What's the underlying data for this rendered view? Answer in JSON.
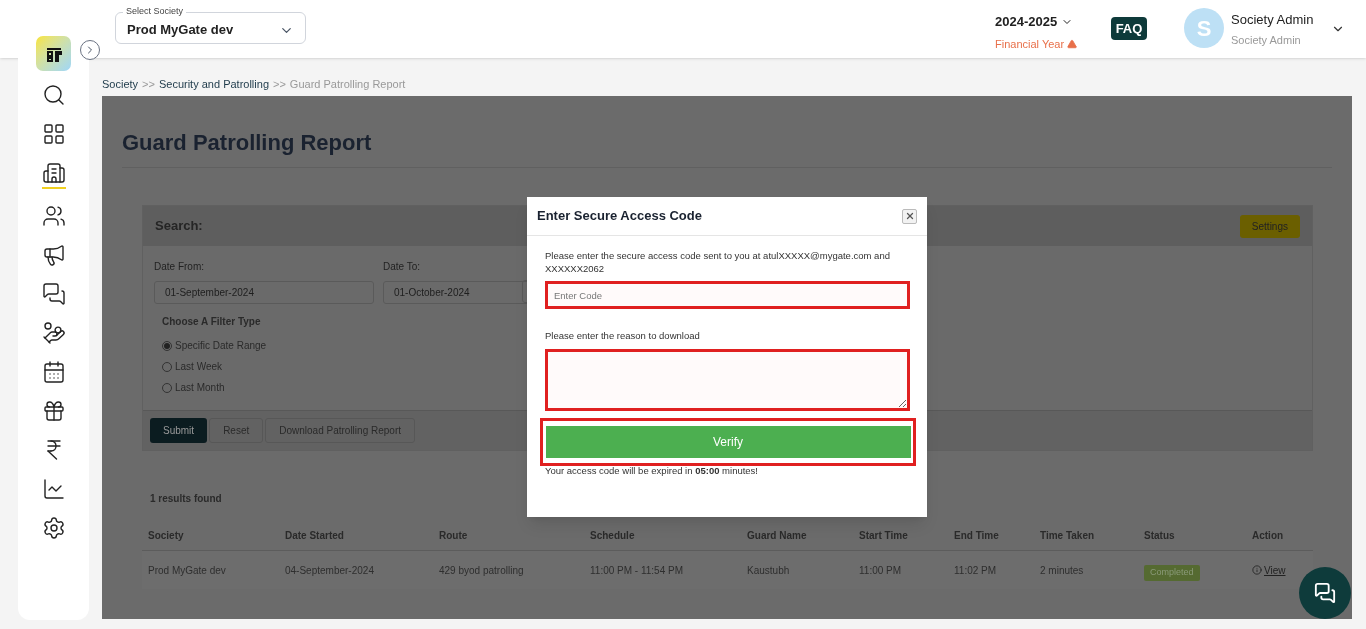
{
  "sidebar": {
    "items": [
      {
        "kind": "search",
        "selected": false
      },
      {
        "kind": "dashboard",
        "selected": false
      },
      {
        "kind": "building",
        "selected": true
      },
      {
        "kind": "people",
        "selected": false
      },
      {
        "kind": "megaphone",
        "selected": false
      },
      {
        "kind": "chat",
        "selected": false
      },
      {
        "kind": "hand",
        "selected": false
      },
      {
        "kind": "calendar",
        "selected": false
      },
      {
        "kind": "gift",
        "selected": false
      },
      {
        "kind": "rupee",
        "selected": false
      },
      {
        "kind": "chart",
        "selected": false
      },
      {
        "kind": "settings",
        "selected": false
      }
    ]
  },
  "header": {
    "society_select": {
      "label": "Select Society",
      "value": "Prod MyGate dev"
    },
    "year": {
      "value": "2024-2025",
      "label": "Financial Year"
    },
    "faq": "FAQ",
    "user": {
      "initial": "S",
      "name": "Society Admin",
      "role": "Society Admin"
    }
  },
  "breadcrumb": [
    {
      "label": "Society",
      "current": false
    },
    {
      "label": "Security and Patrolling",
      "current": false
    },
    {
      "label": "Guard Patrolling Report",
      "current": true
    }
  ],
  "breadcrumb_separator": ">>",
  "page_title": "Guard Patrolling Report",
  "search": {
    "title": "Search:",
    "settings_button": "Settings",
    "date_from": {
      "label": "Date From:",
      "value": "01-September-2024"
    },
    "date_to": {
      "label": "Date To:",
      "value": "01-October-2024"
    },
    "filter_title": "Choose A Filter Type",
    "filters": [
      {
        "label": "Specific Date Range",
        "selected": true
      },
      {
        "label": "Last Week",
        "selected": false
      },
      {
        "label": "Last Month",
        "selected": false
      }
    ],
    "buttons": [
      {
        "label": "Submit",
        "kind": "primary"
      },
      {
        "label": "Reset",
        "kind": "default"
      },
      {
        "label": "Download Patrolling Report",
        "kind": "default"
      }
    ]
  },
  "results_count": "1 results found",
  "table": {
    "columns": [
      "Society",
      "Date Started",
      "Route",
      "Schedule",
      "Guard Name",
      "Start Time",
      "End Time",
      "Time Taken",
      "Status",
      "Action"
    ],
    "rows": [
      {
        "society": "Prod MyGate dev",
        "date_started": "04-September-2024",
        "route": "429 byod patrolling",
        "schedule": "11:00 PM - 11:54 PM",
        "guard_name": "Kaustubh",
        "start_time": "11:00 PM",
        "end_time": "11:02 PM",
        "time_taken": "2 minutes",
        "status": "Completed",
        "action": "View"
      }
    ]
  },
  "dialog": {
    "title": "Enter Secure Access Code",
    "message": "Please enter the secure access code sent to you at atulXXXXX@mygate.com and XXXXXX2062",
    "code_placeholder": "Enter Code",
    "reason_label": "Please enter the reason to download",
    "verify_button": "Verify",
    "expiry": "Your access code will be expired in **05:00** minutes!"
  }
}
